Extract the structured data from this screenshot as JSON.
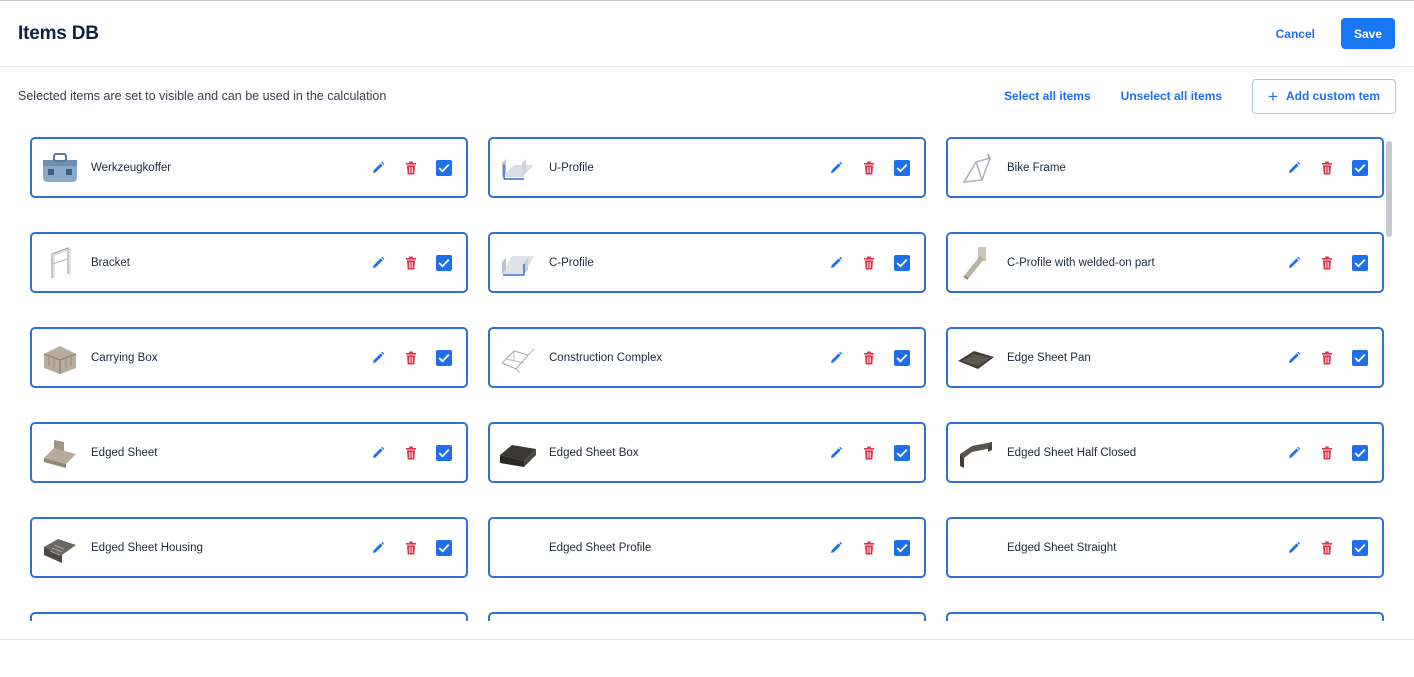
{
  "header": {
    "title": "Items DB",
    "cancel_label": "Cancel",
    "save_label": "Save"
  },
  "toolbar": {
    "hint": "Selected items are set to visible and can be used in the calculation",
    "select_all_label": "Select all items",
    "unselect_all_label": "Unselect all items",
    "add_custom_label": "Add custom tem"
  },
  "colors": {
    "accent": "#1877f2",
    "card_border": "#2e6fd8",
    "delete": "#e0314b"
  },
  "items": [
    {
      "name": "Werkzeugkoffer",
      "icon": "toolbox-icon",
      "checked": true
    },
    {
      "name": "U-Profile",
      "icon": "u-profile-icon",
      "checked": true
    },
    {
      "name": "Bike Frame",
      "icon": "bike-frame-icon",
      "checked": true
    },
    {
      "name": "Bracket",
      "icon": "bracket-icon",
      "checked": true
    },
    {
      "name": "C-Profile",
      "icon": "c-profile-icon",
      "checked": true
    },
    {
      "name": "C-Profile with welded-on part",
      "icon": "welded-part-icon",
      "checked": true
    },
    {
      "name": "Carrying Box",
      "icon": "carrying-box-icon",
      "checked": true
    },
    {
      "name": "Construction Complex",
      "icon": "construction-icon",
      "checked": true
    },
    {
      "name": "Edge Sheet Pan",
      "icon": "sheet-pan-icon",
      "checked": true
    },
    {
      "name": "Edged Sheet",
      "icon": "edged-sheet-icon",
      "checked": true
    },
    {
      "name": "Edged Sheet Box",
      "icon": "sheet-box-icon",
      "checked": true
    },
    {
      "name": "Edged Sheet Half Closed",
      "icon": "half-closed-icon",
      "checked": true
    },
    {
      "name": "Edged Sheet Housing",
      "icon": "housing-icon",
      "checked": true
    },
    {
      "name": "Edged Sheet Profile",
      "icon": "",
      "checked": true
    },
    {
      "name": "Edged Sheet Straight",
      "icon": "",
      "checked": true
    }
  ]
}
